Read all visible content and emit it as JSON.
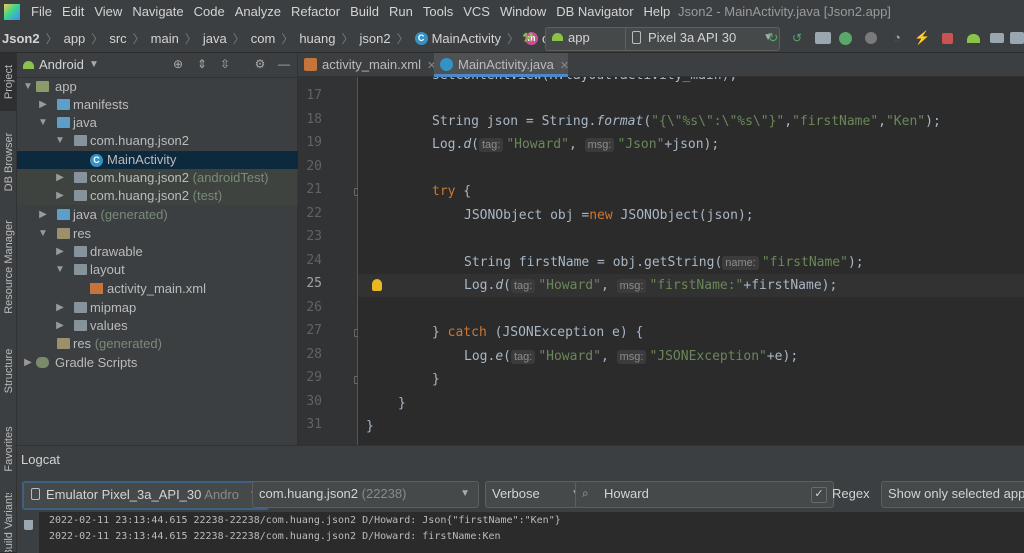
{
  "menubar": {
    "items": [
      "File",
      "Edit",
      "View",
      "Navigate",
      "Code",
      "Analyze",
      "Refactor",
      "Build",
      "Run",
      "Tools",
      "VCS",
      "Window",
      "DB Navigator",
      "Help"
    ],
    "window_title": "Json2 - MainActivity.java [Json2.app]"
  },
  "navbar": {
    "breadcrumbs": [
      "Json2",
      "app",
      "src",
      "main",
      "java",
      "com",
      "huang",
      "json2",
      "MainActivity",
      "onCreate"
    ],
    "run_config": "app",
    "device": "Pixel 3a API 30"
  },
  "left_stripe": {
    "tabs": [
      "Project",
      "DB Browser",
      "Resource Manager",
      "Structure",
      "Favorites",
      "Build Variants"
    ]
  },
  "project_panel": {
    "view": "Android",
    "tree": [
      {
        "label": "app",
        "extra": ""
      },
      {
        "label": "manifests",
        "extra": ""
      },
      {
        "label": "java",
        "extra": ""
      },
      {
        "label": "com.huang.json2",
        "extra": ""
      },
      {
        "label": "MainActivity",
        "extra": ""
      },
      {
        "label": "com.huang.json2",
        "extra": "(androidTest)"
      },
      {
        "label": "com.huang.json2",
        "extra": "(test)"
      },
      {
        "label": "java",
        "extra": "(generated)"
      },
      {
        "label": "res",
        "extra": ""
      },
      {
        "label": "drawable",
        "extra": ""
      },
      {
        "label": "layout",
        "extra": ""
      },
      {
        "label": "activity_main.xml",
        "extra": ""
      },
      {
        "label": "mipmap",
        "extra": ""
      },
      {
        "label": "values",
        "extra": ""
      },
      {
        "label": "res",
        "extra": "(generated)"
      },
      {
        "label": "Gradle Scripts",
        "extra": ""
      }
    ]
  },
  "editor": {
    "tabs": [
      "activity_main.xml",
      "MainActivity.java"
    ],
    "active_tab": "MainActivity.java",
    "partial_top_line": "setContentView(R.layout.activity_main);",
    "line_numbers": [
      "17",
      "18",
      "19",
      "20",
      "21",
      "22",
      "23",
      "24",
      "25",
      "26",
      "27",
      "28",
      "29",
      "30",
      "31"
    ],
    "current_line": "25",
    "hints": {
      "tag": "tag:",
      "msg": "msg:",
      "name": "name:"
    },
    "code": {
      "l18_a": "String json = String.",
      "l18_b": "format",
      "l18_c": "(",
      "l18_s1": "\"{\\\"%s\\\":\\\"%s\\\"}\"",
      "l18_s2": "\"firstName\"",
      "l18_s3": "\"Ken\"",
      "l19_a": "Log.",
      "l19_b": "d",
      "l19_s1": "\"Howard\"",
      "l19_s2": "\"Json\"",
      "l19_c": "+json);",
      "l21_kw": "try",
      "l22_a": "JSONObject obj =",
      "l22_kw": "new",
      "l22_b": " JSONObject(json);",
      "l24_a": "String firstName = obj.getString(",
      "l24_s": "\"firstName\"",
      "l25_s1": "\"Howard\"",
      "l25_s2": "\"firstName:\"",
      "l25_c": "+firstName);",
      "l27_kw": "catch",
      "l27_b": " (JSONException e) {",
      "l28_b": "e",
      "l28_s1": "\"Howard\"",
      "l28_s2": "\"JSONException\"",
      "l28_c": "+e);"
    }
  },
  "logcat": {
    "title": "Logcat",
    "device": "Emulator Pixel_3a_API_30",
    "device_suffix": "Andro",
    "process": "com.huang.json2",
    "pid": "(22238)",
    "level": "Verbose",
    "search": "Howard",
    "regex_label": "Regex",
    "regex_checked": "✓",
    "filter": "Show only selected application",
    "lines": [
      "2022-02-11 23:13:44.615 22238-22238/com.huang.json2 D/Howard: Json{\"firstName\":\"Ken\"}",
      "2022-02-11 23:13:44.615 22238-22238/com.huang.json2 D/Howard: firstName:Ken"
    ]
  },
  "colors": {
    "accent": "#4a88c7",
    "background": "#2b2b2b",
    "panel": "#3c3f41",
    "keyword": "#cc7832",
    "string": "#6a8759"
  }
}
